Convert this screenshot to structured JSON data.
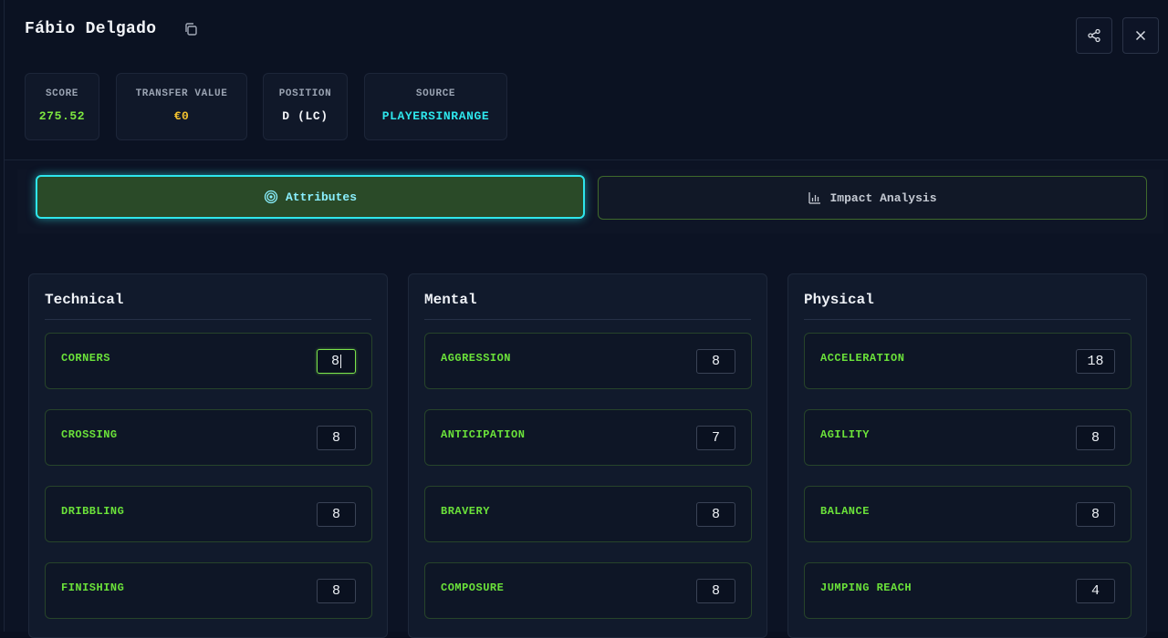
{
  "player": {
    "name": "Fábio Delgado"
  },
  "stats": [
    {
      "label": "SCORE",
      "value": "275.52",
      "color": "#7ee83f"
    },
    {
      "label": "TRANSFER VALUE",
      "value": "€0",
      "color": "#f2c12e"
    },
    {
      "label": "POSITION",
      "value": "D (LC)",
      "color": "#f2f4f8"
    },
    {
      "label": "SOURCE",
      "value": "PLAYERSINRANGE",
      "color": "#2ee6ec"
    }
  ],
  "tabs": [
    {
      "label": "Attributes",
      "icon": "target-icon",
      "active": true
    },
    {
      "label": "Impact Analysis",
      "icon": "bar-chart-icon",
      "active": false
    }
  ],
  "panels": [
    {
      "title": "Technical",
      "attributes": [
        {
          "name": "CORNERS",
          "value": "8"
        },
        {
          "name": "CROSSING",
          "value": "8"
        },
        {
          "name": "DRIBBLING",
          "value": "8"
        },
        {
          "name": "FINISHING",
          "value": "8"
        }
      ]
    },
    {
      "title": "Mental",
      "attributes": [
        {
          "name": "AGGRESSION",
          "value": "8"
        },
        {
          "name": "ANTICIPATION",
          "value": "7"
        },
        {
          "name": "BRAVERY",
          "value": "8"
        },
        {
          "name": "COMPOSURE",
          "value": "8"
        }
      ]
    },
    {
      "title": "Physical",
      "attributes": [
        {
          "name": "ACCELERATION",
          "value": "18"
        },
        {
          "name": "AGILITY",
          "value": "8"
        },
        {
          "name": "BALANCE",
          "value": "8"
        },
        {
          "name": "JUMPING REACH",
          "value": "4"
        }
      ]
    }
  ],
  "icons": {
    "copy": "copy-icon",
    "share": "share-icon",
    "close": "close-icon"
  }
}
